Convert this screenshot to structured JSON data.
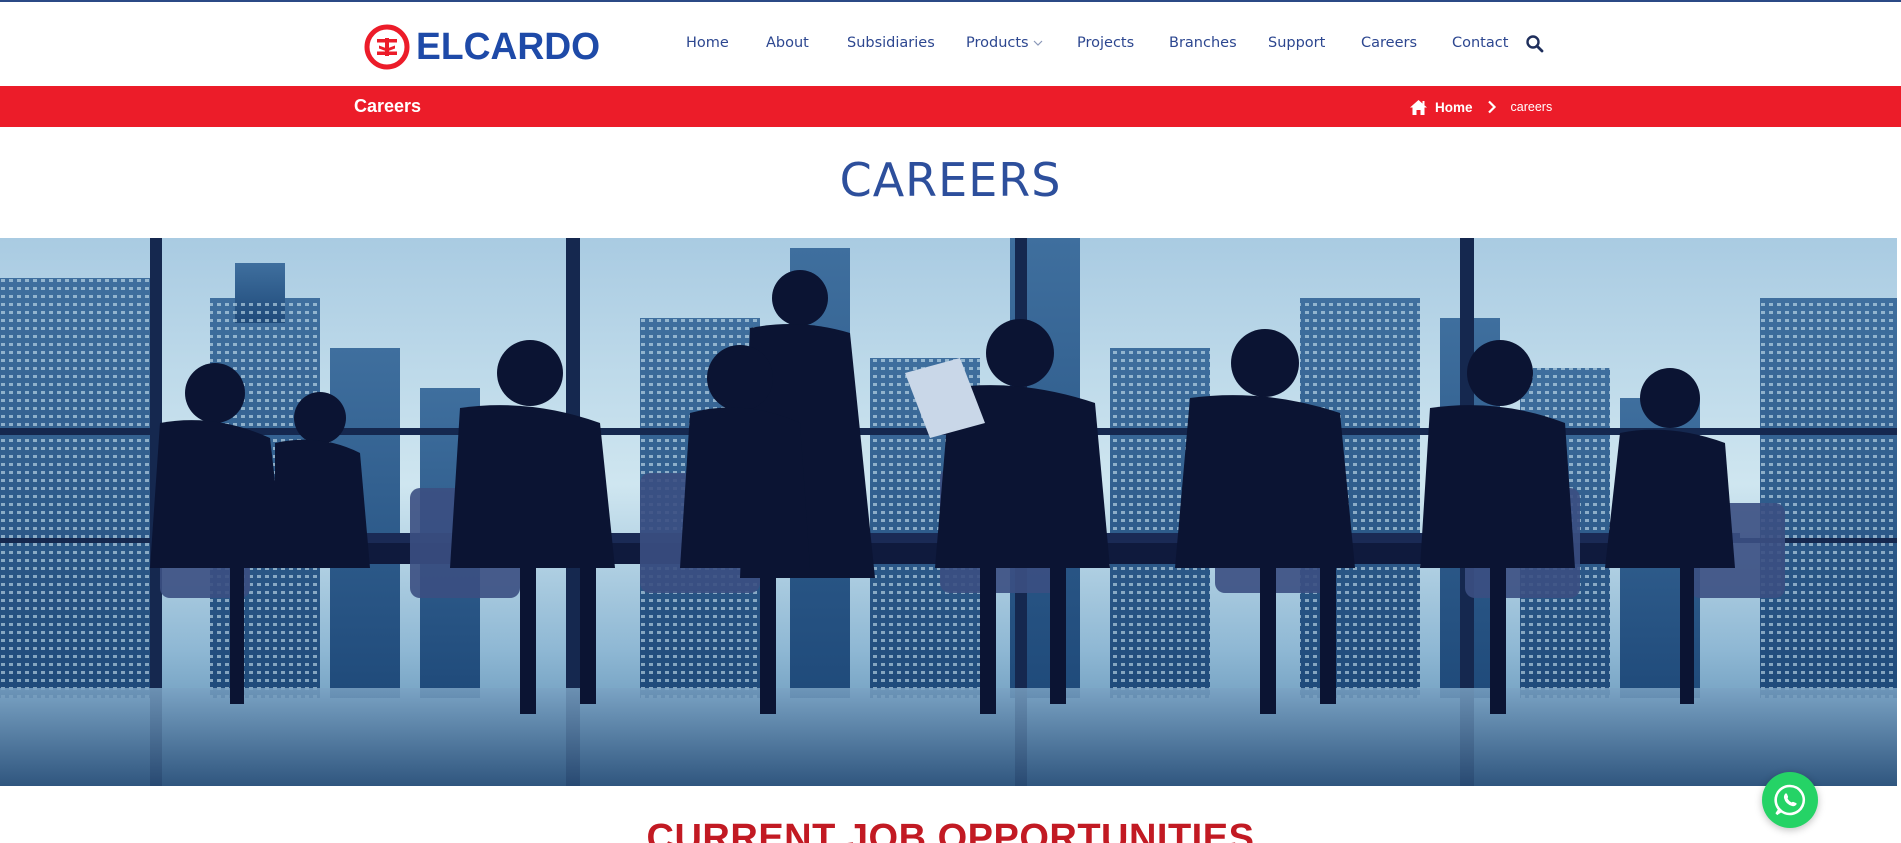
{
  "brand": {
    "name": "ELCARDO",
    "logo_icon": "elcardo-logo-icon",
    "colors": {
      "primary_blue": "#1e4aa8",
      "accent_red": "#ec1c29",
      "nav_text": "#2d4790",
      "heading_red": "#c21a23",
      "whatsapp_green": "#25d366"
    }
  },
  "nav": {
    "items": [
      {
        "label": "Home"
      },
      {
        "label": "About"
      },
      {
        "label": "Subsidiaries"
      },
      {
        "label": "Products",
        "has_dropdown": true
      },
      {
        "label": "Projects"
      },
      {
        "label": "Branches"
      },
      {
        "label": "Support"
      },
      {
        "label": "Careers"
      },
      {
        "label": "Contact"
      }
    ],
    "search_icon": "search-icon"
  },
  "crumbbar": {
    "title": "Careers",
    "home_icon": "home-icon",
    "home_label": "Home",
    "separator_icon": "chevron-right-icon",
    "current": "careers"
  },
  "page": {
    "heading": "CAREERS",
    "hero_image": "business-meeting-silhouette-photo",
    "section_heading": "CURRENT JOB OPPORTUNITIES"
  },
  "floating": {
    "whatsapp_icon": "whatsapp-icon"
  }
}
